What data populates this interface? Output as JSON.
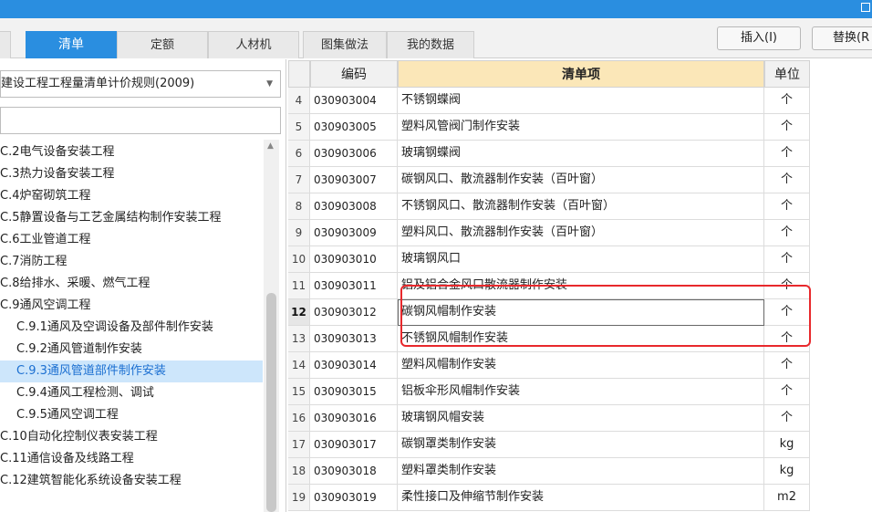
{
  "tabs": [
    {
      "label": "",
      "active": false
    },
    {
      "label": "清单",
      "active": true
    },
    {
      "label": "定额",
      "active": false
    },
    {
      "label": "人材机",
      "active": false
    },
    {
      "label": "图集做法",
      "active": false
    },
    {
      "label": "我的数据",
      "active": false
    }
  ],
  "toolbar": {
    "insert_label": "插入(I)",
    "replace_label": "替换(R"
  },
  "rule_select": {
    "value": "建设工程工程量清单计价规则(2009)"
  },
  "tree": [
    {
      "label": "C.2电气设备安装工程",
      "level": 0
    },
    {
      "label": "C.3热力设备安装工程",
      "level": 0
    },
    {
      "label": "C.4炉窑砌筑工程",
      "level": 0
    },
    {
      "label": "C.5静置设备与工艺金属结构制作安装工程",
      "level": 0
    },
    {
      "label": "C.6工业管道工程",
      "level": 0
    },
    {
      "label": "C.7消防工程",
      "level": 0
    },
    {
      "label": "C.8给排水、采暖、燃气工程",
      "level": 0
    },
    {
      "label": "C.9通风空调工程",
      "level": 0
    },
    {
      "label": "C.9.1通风及空调设备及部件制作安装",
      "level": 1
    },
    {
      "label": "C.9.2通风管道制作安装",
      "level": 1
    },
    {
      "label": "C.9.3通风管道部件制作安装",
      "level": 1,
      "selected": true
    },
    {
      "label": "C.9.4通风工程检测、调试",
      "level": 1
    },
    {
      "label": "C.9.5通风空调工程",
      "level": 1
    },
    {
      "label": "C.10自动化控制仪表安装工程",
      "level": 0
    },
    {
      "label": "C.11通信设备及线路工程",
      "level": 0
    },
    {
      "label": "C.12建筑智能化系统设备安装工程",
      "level": 0
    }
  ],
  "grid": {
    "headers": {
      "code": "编码",
      "name": "清单项",
      "unit": "单位"
    },
    "rows": [
      {
        "num": "4",
        "code": "030903004",
        "name": "不锈钢蝶阀",
        "unit": "个"
      },
      {
        "num": "5",
        "code": "030903005",
        "name": "塑料风管阀门制作安装",
        "unit": "个"
      },
      {
        "num": "6",
        "code": "030903006",
        "name": "玻璃钢蝶阀",
        "unit": "个"
      },
      {
        "num": "7",
        "code": "030903007",
        "name": "碳钢风口、散流器制作安装（百叶窗）",
        "unit": "个"
      },
      {
        "num": "8",
        "code": "030903008",
        "name": "不锈钢风口、散流器制作安装（百叶窗）",
        "unit": "个"
      },
      {
        "num": "9",
        "code": "030903009",
        "name": "塑料风口、散流器制作安装（百叶窗）",
        "unit": "个"
      },
      {
        "num": "10",
        "code": "030903010",
        "name": "玻璃钢风口",
        "unit": "个"
      },
      {
        "num": "11",
        "code": "030903011",
        "name": "铝及铝合金风口散流器制作安装",
        "unit": "个"
      },
      {
        "num": "12",
        "code": "030903012",
        "name": "碳钢风帽制作安装",
        "unit": "个",
        "current": true
      },
      {
        "num": "13",
        "code": "030903013",
        "name": "不锈钢风帽制作安装",
        "unit": "个"
      },
      {
        "num": "14",
        "code": "030903014",
        "name": "塑料风帽制作安装",
        "unit": "个"
      },
      {
        "num": "15",
        "code": "030903015",
        "name": "铝板伞形风帽制作安装",
        "unit": "个"
      },
      {
        "num": "16",
        "code": "030903016",
        "name": "玻璃钢风帽安装",
        "unit": "个"
      },
      {
        "num": "17",
        "code": "030903017",
        "name": "碳钢罩类制作安装",
        "unit": "kg"
      },
      {
        "num": "18",
        "code": "030903018",
        "name": "塑料罩类制作安装",
        "unit": "kg"
      },
      {
        "num": "19",
        "code": "030903019",
        "name": "柔性接口及伸缩节制作安装",
        "unit": "m2"
      }
    ]
  },
  "colors": {
    "accent": "#2a8ee0",
    "highlight_box": "#e8282c",
    "selected_bg": "#cde6fb",
    "header_highlight": "#fbe7b8"
  }
}
